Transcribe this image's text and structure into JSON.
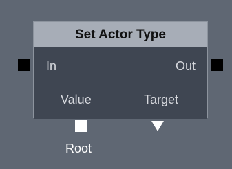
{
  "node": {
    "title": "Set Actor Type",
    "inputs": {
      "exec_label": "In",
      "value_label": "Value"
    },
    "outputs": {
      "exec_label": "Out",
      "target_label": "Target"
    }
  },
  "below_node": {
    "root_label": "Root"
  },
  "colors": {
    "canvas_background": "#5f6773",
    "node_header": "#a7adb7",
    "node_body": "#3f4652",
    "pin_exec": "#000000",
    "pin_data": "#ffffff"
  },
  "icons": {
    "exec_in": "square-pin-icon",
    "exec_out": "square-pin-icon",
    "root": "square-pin-icon",
    "target": "triangle-down-pin-icon"
  }
}
